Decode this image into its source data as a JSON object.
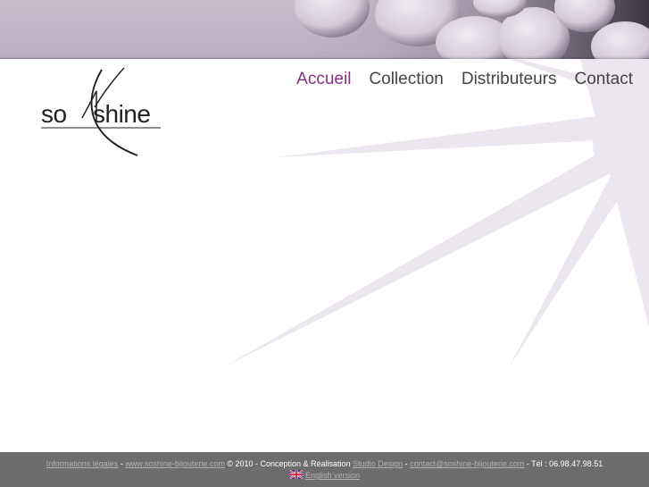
{
  "logo": {
    "part1": "so",
    "part2": "shine"
  },
  "nav": {
    "items": [
      {
        "label": "Accueil",
        "active": true
      },
      {
        "label": "Collection",
        "active": false
      },
      {
        "label": "Distributeurs",
        "active": false
      },
      {
        "label": "Contact",
        "active": false
      }
    ]
  },
  "colors": {
    "accent": "#8a2e86",
    "footer_bg": "#6d6d6d",
    "banner": "#c4b8c8",
    "starburst": "#ece6ee"
  },
  "footer": {
    "legal_link": "Informations légales",
    "sep1": " - ",
    "site_link": "www.soshine-bijouterie.com",
    "credits": " © 2010 - Conception & Réalisation ",
    "studio_link": "Studio Design",
    "sep2": " - ",
    "email_link": "contact@soshine-bijouterie.com",
    "phone": " - Tél : 06.98.47.98.51",
    "english_link": "English version"
  }
}
